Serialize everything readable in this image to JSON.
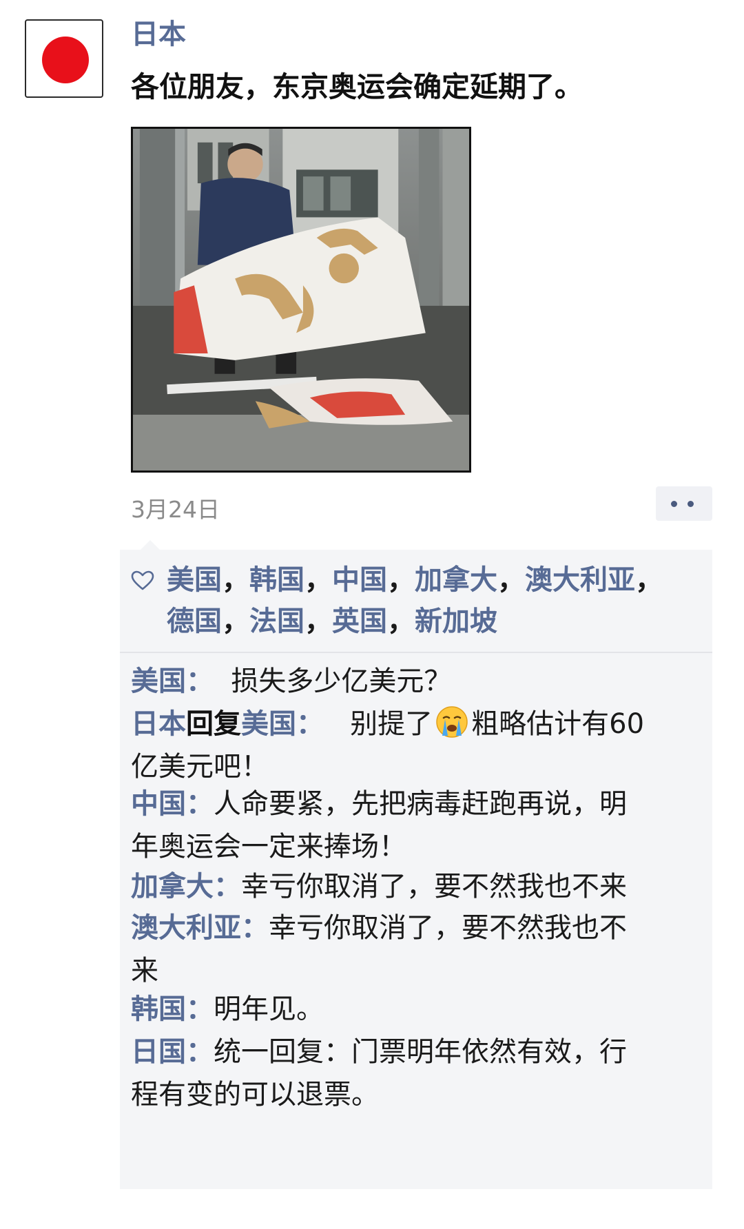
{
  "post": {
    "username": "日本",
    "text": "各位朋友，东京奥运会确定延期了。",
    "date": "3月24日",
    "image_description_icon": "photo-torn-olympic-banner"
  },
  "likes": {
    "line1": [
      "美国",
      "韩国",
      "中国",
      "加拿大",
      "澳大利亚"
    ],
    "line2": [
      "德国",
      "法国",
      "英国",
      "新加坡"
    ],
    "separator": "，"
  },
  "comments": [
    {
      "author": "美国",
      "colon": "：",
      "text": "损失多少亿美元？"
    },
    {
      "author": "日本",
      "reply_word": "回复",
      "reply_to": "美国",
      "colon": "：",
      "text_before_emoji": "别提了",
      "emoji": "crying-face-icon",
      "text_after_emoji_line1": "粗略估计有60",
      "text_line2": "亿美元吧！"
    },
    {
      "author": "中国",
      "colon": "：",
      "text_line1": "人命要紧，先把病毒赶跑再说，明",
      "text_line2": "年奥运会一定来捧场！"
    },
    {
      "author": "加拿大",
      "colon": "：",
      "text": "幸亏你取消了，要不然我也不来"
    },
    {
      "author": "澳大利亚",
      "colon": "：",
      "text_line1": "幸亏你取消了，要不然我也不",
      "text_line2": "来"
    },
    {
      "author": "韩国",
      "colon": "：",
      "text": "明年见。"
    },
    {
      "author": "日国",
      "colon": "：",
      "text_line1": "统一回复：门票明年依然有效，行",
      "text_line2": "程有变的可以退票。"
    }
  ],
  "colors": {
    "name_link": "#576b95",
    "flag_red": "#e8101a",
    "comment_bg": "#f4f5f7"
  }
}
